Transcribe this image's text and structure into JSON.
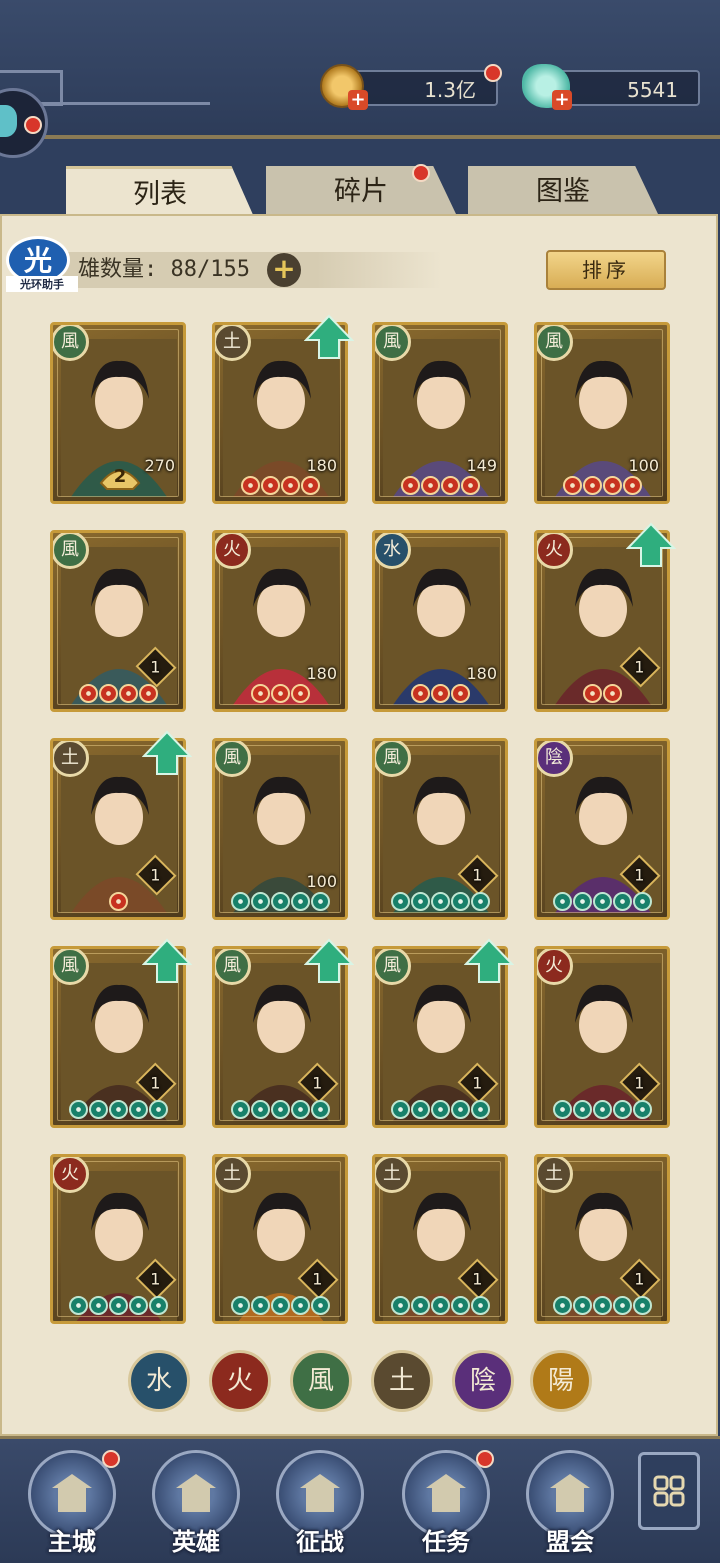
{
  "currency": {
    "coins": "1.3亿",
    "jade": "5541"
  },
  "tabs": [
    {
      "label": "列表",
      "active": true
    },
    {
      "label": "碎片",
      "active": false
    },
    {
      "label": "图鉴",
      "active": false
    }
  ],
  "hero_count": {
    "label": "雄数量:",
    "value": "88/155"
  },
  "sort_button": "排序",
  "brand_badge": {
    "glyph": "光",
    "text": "光环助手"
  },
  "element_glyphs": {
    "wind": "風",
    "earth": "土",
    "fire": "火",
    "water": "水",
    "yin": "陰",
    "yang": "陽"
  },
  "element_colors": {
    "wind": "#3f6f45",
    "earth": "#5a4a30",
    "fire": "#8c2a1e",
    "water": "#27506a",
    "yin": "#5a2f7a",
    "yang": "#b07a18"
  },
  "cards": [
    {
      "element": "wind",
      "level": "270",
      "stars": 0,
      "star_color": "red",
      "dup": "2",
      "upgrade": false
    },
    {
      "element": "earth",
      "level": "180",
      "stars": 4,
      "star_color": "red",
      "dup": "",
      "upgrade": true
    },
    {
      "element": "wind",
      "level": "149",
      "stars": 4,
      "star_color": "red",
      "dup": "",
      "upgrade": false
    },
    {
      "element": "wind",
      "level": "100",
      "stars": 4,
      "star_color": "red",
      "dup": "",
      "upgrade": false
    },
    {
      "element": "wind",
      "level": "1",
      "stars": 4,
      "star_color": "red",
      "dup": "",
      "upgrade": false
    },
    {
      "element": "fire",
      "level": "180",
      "stars": 3,
      "star_color": "red",
      "dup": "",
      "upgrade": false
    },
    {
      "element": "water",
      "level": "180",
      "stars": 3,
      "star_color": "red",
      "dup": "",
      "upgrade": false
    },
    {
      "element": "fire",
      "level": "1",
      "stars": 2,
      "star_color": "red",
      "dup": "",
      "upgrade": true
    },
    {
      "element": "earth",
      "level": "1",
      "stars": 1,
      "star_color": "red",
      "dup": "",
      "upgrade": true
    },
    {
      "element": "wind",
      "level": "100",
      "stars": 5,
      "star_color": "green",
      "dup": "",
      "upgrade": false
    },
    {
      "element": "wind",
      "level": "1",
      "stars": 5,
      "star_color": "green",
      "dup": "",
      "upgrade": false
    },
    {
      "element": "yin",
      "level": "1",
      "stars": 5,
      "star_color": "green",
      "dup": "",
      "upgrade": false
    },
    {
      "element": "wind",
      "level": "1",
      "stars": 5,
      "star_color": "green",
      "dup": "",
      "upgrade": true
    },
    {
      "element": "wind",
      "level": "1",
      "stars": 5,
      "star_color": "green",
      "dup": "",
      "upgrade": true
    },
    {
      "element": "wind",
      "level": "1",
      "stars": 5,
      "star_color": "green",
      "dup": "",
      "upgrade": true
    },
    {
      "element": "fire",
      "level": "1",
      "stars": 5,
      "star_color": "green",
      "dup": "",
      "upgrade": false
    },
    {
      "element": "fire",
      "level": "1",
      "stars": 5,
      "star_color": "green",
      "dup": "",
      "upgrade": false
    },
    {
      "element": "earth",
      "level": "1",
      "stars": 5,
      "star_color": "green",
      "dup": "",
      "upgrade": false
    },
    {
      "element": "earth",
      "level": "1",
      "stars": 5,
      "star_color": "green",
      "dup": "",
      "upgrade": false
    },
    {
      "element": "earth",
      "level": "1",
      "stars": 5,
      "star_color": "green",
      "dup": "",
      "upgrade": false
    }
  ],
  "filters": [
    "water",
    "fire",
    "wind",
    "earth",
    "yin",
    "yang"
  ],
  "nav": [
    {
      "label": "主城",
      "badge": true
    },
    {
      "label": "英雄",
      "badge": false
    },
    {
      "label": "征战",
      "badge": false
    },
    {
      "label": "任务",
      "badge": true
    },
    {
      "label": "盟会",
      "badge": false
    }
  ]
}
